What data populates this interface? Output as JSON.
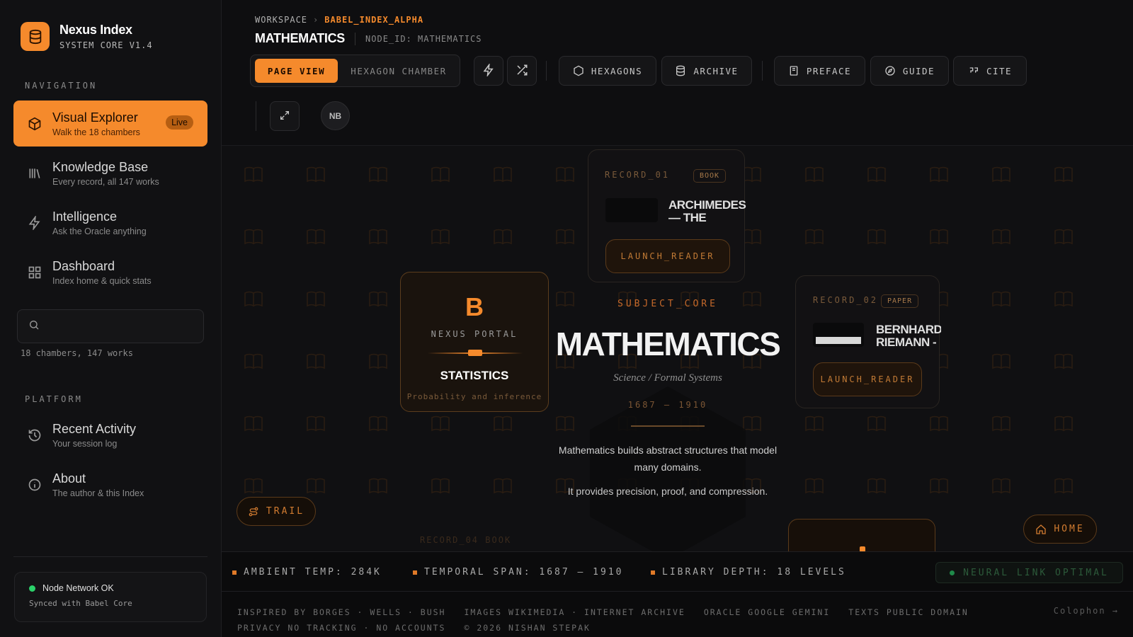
{
  "brand": {
    "name": "Nexus Index",
    "version": "SYSTEM CORE V1.4"
  },
  "sidebar": {
    "navigation_label": "NAVIGATION",
    "nav": [
      {
        "title": "Visual Explorer",
        "desc": "Walk the 18 chambers",
        "badge": "Live",
        "icon": "cube-icon"
      },
      {
        "title": "Knowledge Base",
        "desc": "Every record, all 147 works",
        "icon": "library-icon"
      },
      {
        "title": "Intelligence",
        "desc": "Ask the Oracle anything",
        "icon": "lightning-icon"
      },
      {
        "title": "Dashboard",
        "desc": "Index home & quick stats",
        "icon": "grid-icon"
      }
    ],
    "search": {
      "placeholder": "",
      "stats": "18 chambers, 147 works"
    },
    "platform_label": "PLATFORM",
    "platform": [
      {
        "title": "Recent Activity",
        "desc": "Your session log",
        "icon": "history-icon"
      },
      {
        "title": "About",
        "desc": "The author & this Index",
        "icon": "info-icon"
      }
    ],
    "status": {
      "title": "Node Network OK",
      "sub": "Synced with Babel Core"
    }
  },
  "header": {
    "breadcrumb": {
      "root": "WORKSPACE",
      "current": "BABEL_INDEX_ALPHA"
    },
    "title": "MATHEMATICS",
    "node_id": "NODE_ID: MATHEMATICS",
    "view_options": [
      "PAGE VIEW",
      "HEXAGON CHAMBER"
    ],
    "buttons": {
      "hexagons": "HEXAGONS",
      "archive": "ARCHIVE",
      "preface": "PREFACE",
      "guide": "GUIDE",
      "cite": "CITE"
    },
    "avatar": "NB"
  },
  "canvas": {
    "record1": {
      "label": "RECORD_01",
      "tag": "BOOK",
      "title": "ARCHIMEDES — THE",
      "button": "LAUNCH_READER"
    },
    "record2": {
      "label": "RECORD_02",
      "tag": "PAPER",
      "title": "BERNHARD RIEMANN -",
      "button": "LAUNCH_READER"
    },
    "record4": {
      "label": "RECORD_04",
      "tag": "BOOK"
    },
    "portal": {
      "letter": "B",
      "label": "NEXUS PORTAL",
      "name": "STATISTICS",
      "desc": "Probability and inference"
    },
    "subject": {
      "label": "SUBJECT_CORE",
      "title": "MATHEMATICS",
      "subtitle": "Science / Formal Systems",
      "years": "1687 — 1910",
      "desc1": "Mathematics builds abstract structures that model many domains.",
      "desc2": "It provides precision, proof, and compression."
    },
    "trail": "TRAIL",
    "home": "HOME"
  },
  "statusbar": {
    "temp": "AMBIENT TEMP: 284K",
    "span": "TEMPORAL SPAN: 1687 — 1910",
    "depth": "LIBRARY DEPTH: 18 LEVELS",
    "neural": "NEURAL LINK OPTIMAL"
  },
  "footer": {
    "row1": [
      "INSPIRED BY BORGES · WELLS · BUSH",
      "IMAGES WIKIMEDIA · INTERNET ARCHIVE",
      "ORACLE GOOGLE GEMINI",
      "TEXTS PUBLIC DOMAIN"
    ],
    "row2": [
      "PRIVACY NO TRACKING · NO ACCOUNTS",
      "© 2026 NISHAN STEPAK"
    ],
    "colophon": "Colophon →"
  },
  "colors": {
    "accent": "#f58a2c",
    "ok": "#2bd16a"
  }
}
